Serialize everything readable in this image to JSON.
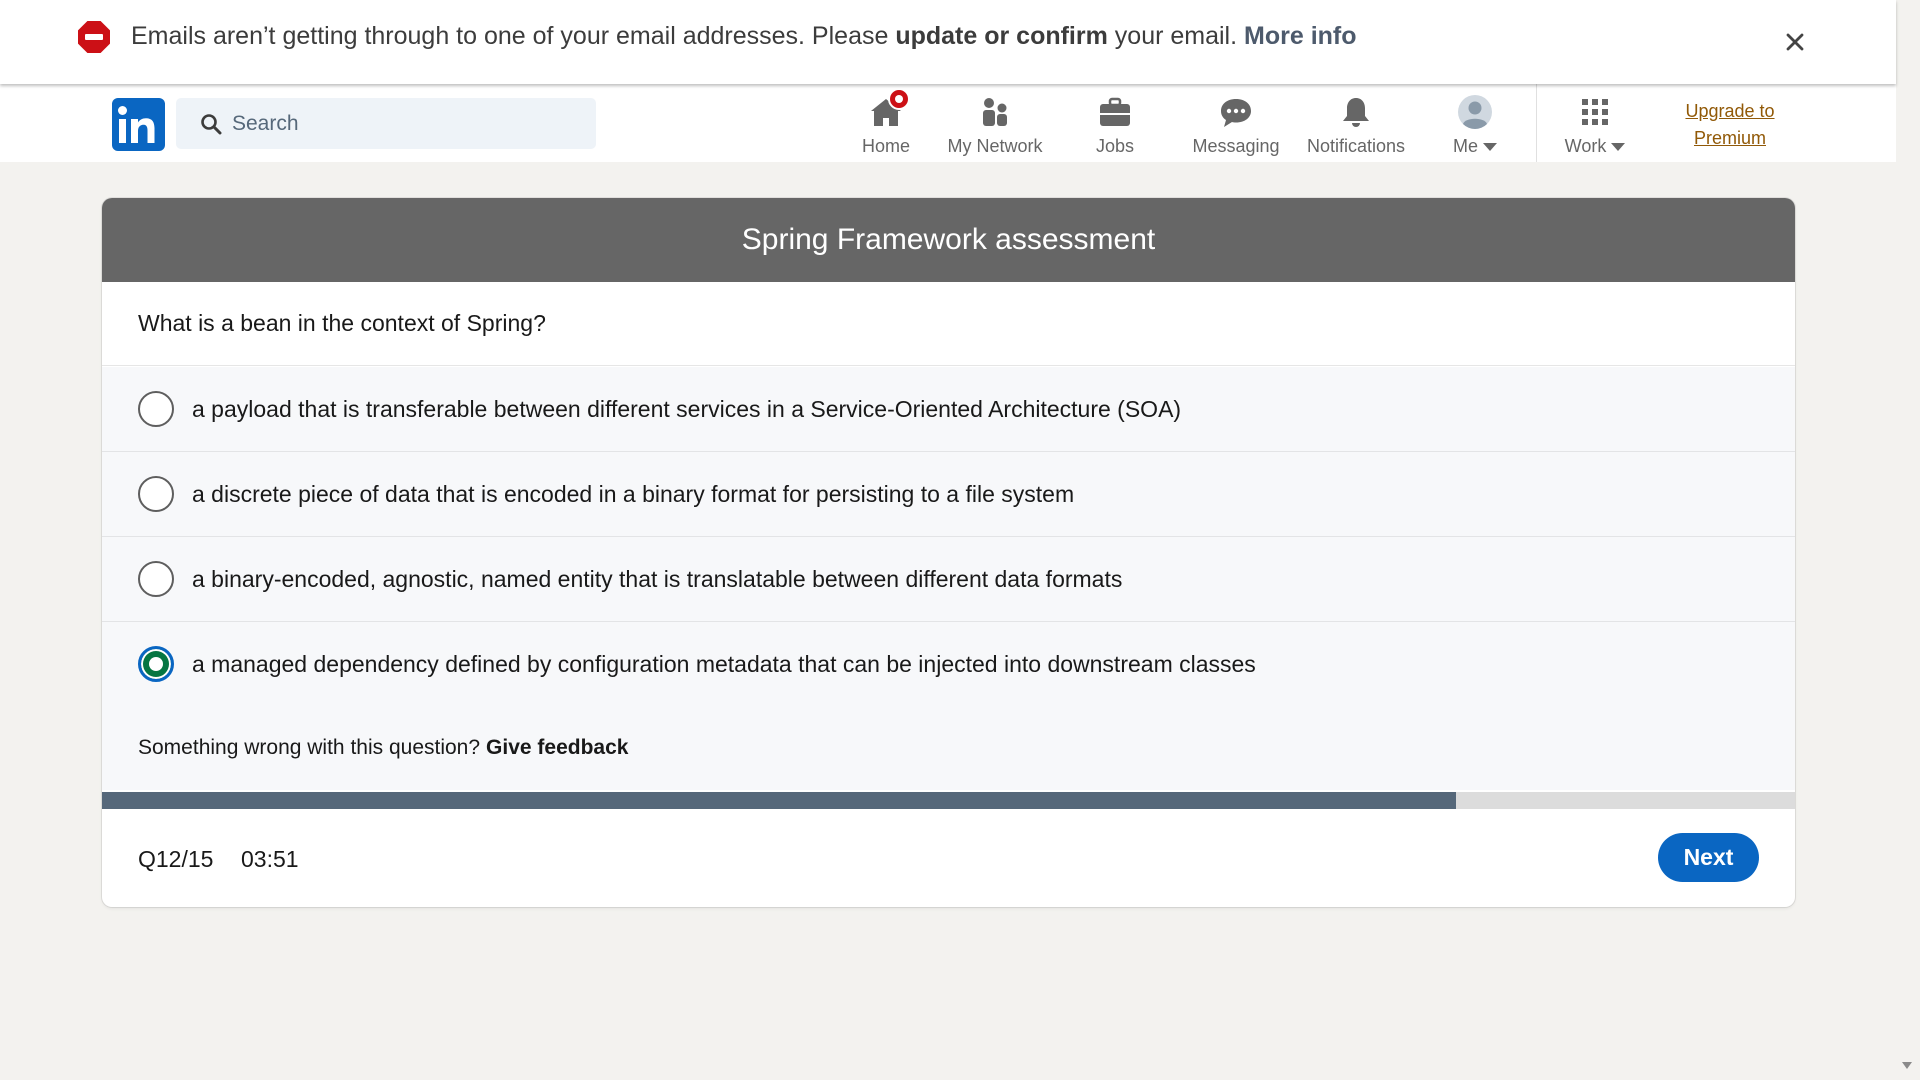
{
  "banner": {
    "text_pre": "Emails aren’t getting through to one of your email addresses. Please ",
    "text_bold": "update or confirm",
    "text_post": " your email. ",
    "more_info": "More info",
    "icon": "stop-icon",
    "close_icon": "close-icon"
  },
  "nav": {
    "logo": "in",
    "search_placeholder": "Search",
    "items": [
      {
        "label": "Home",
        "icon": "home-icon"
      },
      {
        "label": "My Network",
        "icon": "network-icon"
      },
      {
        "label": "Jobs",
        "icon": "briefcase-icon"
      },
      {
        "label": "Messaging",
        "icon": "messaging-icon"
      },
      {
        "label": "Notifications",
        "icon": "bell-icon"
      },
      {
        "label": "Me",
        "icon": "avatar"
      },
      {
        "label": "Work",
        "icon": "grid-icon"
      }
    ],
    "premium_line1": "Upgrade to",
    "premium_line2": "Premium"
  },
  "assessment": {
    "title": "Spring Framework assessment",
    "question": "What is a bean in the context of Spring?",
    "options": [
      {
        "text": "a payload that is transferable between different services in a Service-Oriented Architecture (SOA)",
        "selected": false
      },
      {
        "text": "a discrete piece of data that is encoded in a binary format for persisting to a file system",
        "selected": false
      },
      {
        "text": "a binary-encoded, agnostic, named entity that is translatable between different data formats",
        "selected": false
      },
      {
        "text": "a managed dependency defined by configuration metadata that can be injected into downstream classes",
        "selected": true
      }
    ],
    "feedback_prompt": "Something wrong with this question?",
    "feedback_link": "Give feedback",
    "progress_fraction": 0.8,
    "question_number": "Q12/15",
    "timer": "03:51",
    "next_label": "Next"
  },
  "colors": {
    "brand": "#0a66c2",
    "header_bg": "#666666",
    "selected_radio": "#057642",
    "progress_fill": "#56687a",
    "premium": "#915907",
    "badge": "#cc1016"
  }
}
